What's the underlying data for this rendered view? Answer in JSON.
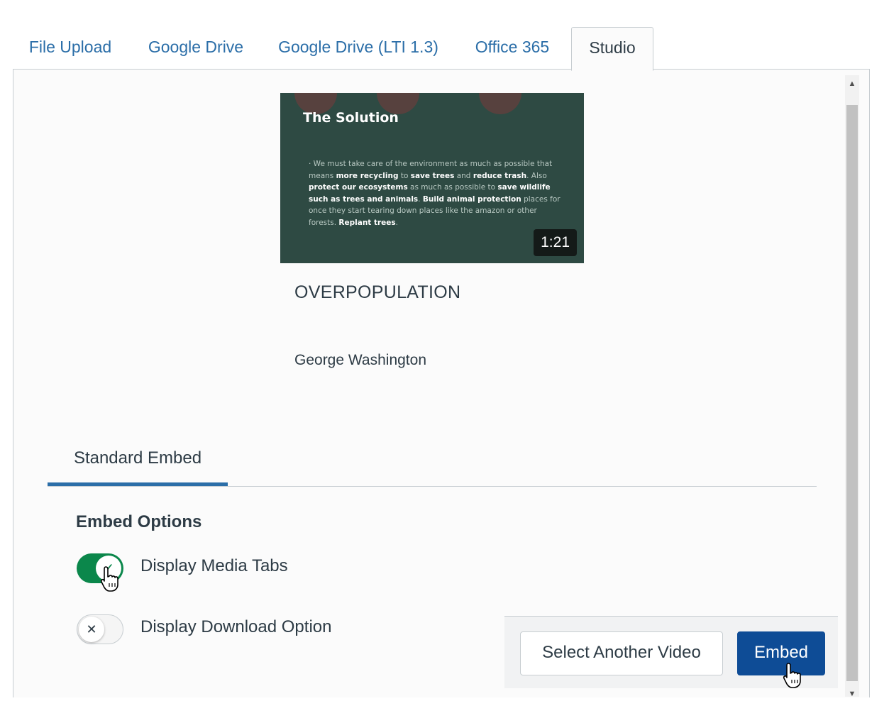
{
  "tabs": [
    {
      "label": "File Upload"
    },
    {
      "label": "Google Drive"
    },
    {
      "label": "Google Drive (LTI 1.3)"
    },
    {
      "label": "Office 365"
    },
    {
      "label": "Studio",
      "active": true
    }
  ],
  "video": {
    "slide_title": "The Solution",
    "slide_text": "We must take care of the environment as much as possible that means more recycling to save trees and reduce trash. Also protect our ecosystems as much as possible to save wildlife such as trees and animals. Build animal protection places for once they start tearing down places like the amazon or other forests. Replant trees.",
    "duration": "1:21",
    "title": "OVERPOPULATION",
    "author": "George Washington"
  },
  "embed": {
    "tab_label": "Standard Embed",
    "options_heading": "Embed Options",
    "options": [
      {
        "label": "Display Media Tabs",
        "enabled": true
      },
      {
        "label": "Display Download Option",
        "enabled": false
      }
    ]
  },
  "footer": {
    "select_another_label": "Select Another Video",
    "embed_label": "Embed"
  },
  "colors": {
    "link": "#2b6ea8",
    "primary_button": "#0e4c96",
    "toggle_on": "#0b874b",
    "thumbnail_bg": "#2e4a43"
  }
}
